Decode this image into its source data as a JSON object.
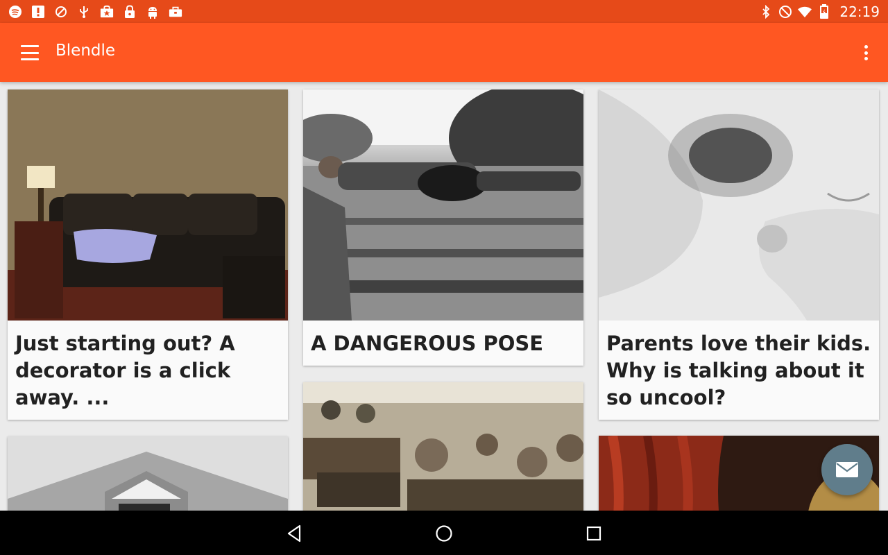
{
  "status_bar": {
    "left_icons": [
      "spotify-icon",
      "alert-icon",
      "blocked-icon",
      "usb-icon",
      "store-icon",
      "lock-icon",
      "android-icon",
      "briefcase-icon"
    ],
    "right_icons": [
      "bluetooth-icon",
      "do-not-disturb-icon",
      "wifi-icon",
      "battery-icon"
    ],
    "time": "22:19"
  },
  "app_bar": {
    "title": "Blendle",
    "color": "#ff5722",
    "status_color": "#e64a19"
  },
  "cards": [
    {
      "title": "Just starting out? A decorator is a click away. ...",
      "image": "living-room-sofa-photo"
    },
    {
      "title": "A DANGEROUS POSE",
      "image": "man-with-guitar-on-railroad-tracks-photo"
    },
    {
      "title": "Parents love their kids. Why is talking about it so uncool?",
      "image": "parent-and-baby-faces-photo"
    },
    {
      "title": "",
      "image": "barn-roof-photo"
    },
    {
      "title": "",
      "image": "vintage-classroom-children-photo"
    },
    {
      "title": "",
      "image": "red-curtain-painting-photo"
    }
  ],
  "fab": {
    "icon": "mail-icon",
    "color": "#607d8b"
  },
  "nav_bar": {
    "buttons": [
      "back-icon",
      "home-icon",
      "recents-icon"
    ]
  }
}
